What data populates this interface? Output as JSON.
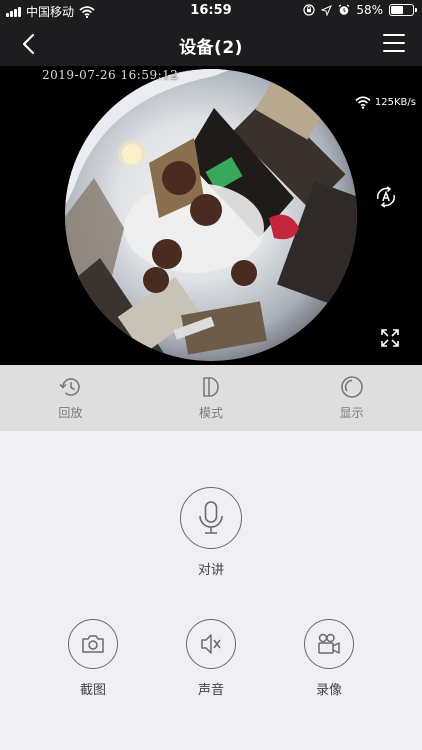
{
  "status_bar": {
    "carrier": "中国移动",
    "time": "16:59",
    "battery": "58%",
    "battery_level": 0.58
  },
  "nav": {
    "title": "设备(2)",
    "back_icon": "chevron-left-icon",
    "menu_icon": "hamburger-menu-icon"
  },
  "video": {
    "timestamp": "2019-07-26 16:59:12",
    "speed": "125KB/s"
  },
  "toolbar": {
    "items": [
      {
        "label": "回放",
        "icon": "history-icon"
      },
      {
        "label": "模式",
        "icon": "mode-icon"
      },
      {
        "label": "显示",
        "icon": "display-icon"
      }
    ]
  },
  "controls": {
    "talk_label": "对讲",
    "snapshot_label": "截图",
    "sound_label": "声音",
    "record_label": "录像"
  },
  "colors": {
    "bar_bg": "#1d1d1f",
    "toolbar_bg": "#dedede",
    "page_bg": "#efeff4"
  }
}
